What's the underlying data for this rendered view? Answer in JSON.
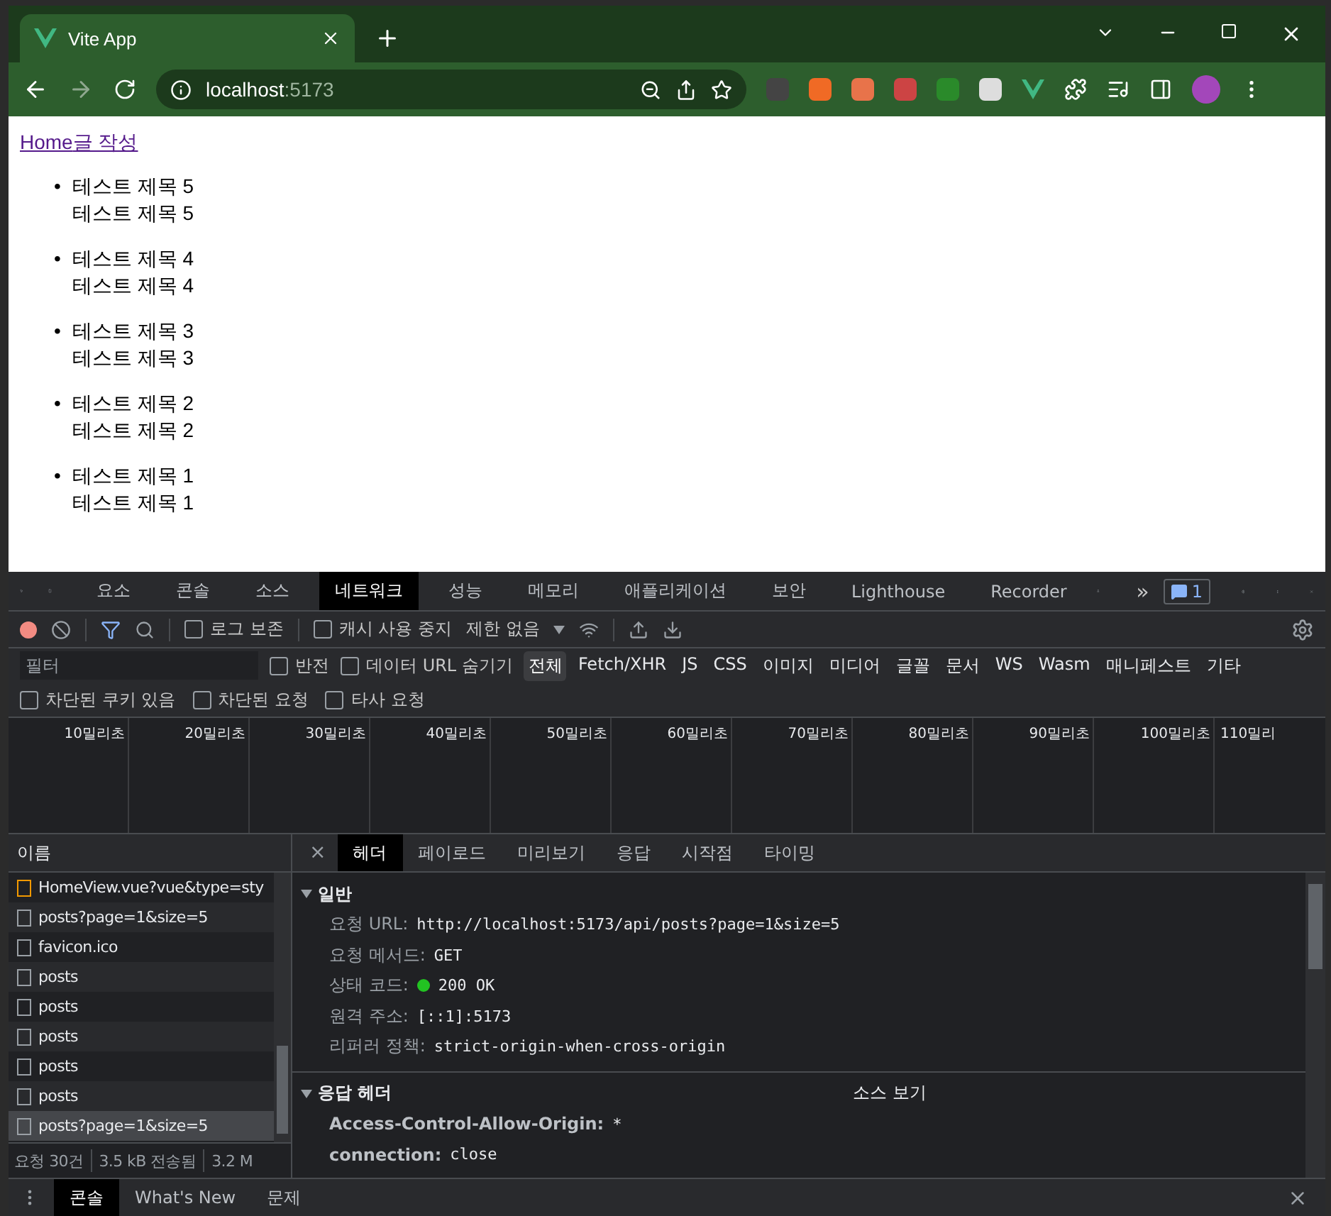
{
  "browser": {
    "tab_title": "Vite App",
    "url_host": "localhost",
    "url_port": ":5173"
  },
  "page": {
    "links": [
      "Home",
      "글 작성"
    ],
    "posts": [
      {
        "bullet": "•",
        "title": "테스트 제목 5",
        "content": "테스트 제목 5"
      },
      {
        "bullet": "•",
        "title": "테스트 제목 4",
        "content": "테스트 제목 4"
      },
      {
        "bullet": "•",
        "title": "테스트 제목 3",
        "content": "테스트 제목 3"
      },
      {
        "bullet": "•",
        "title": "테스트 제목 2",
        "content": "테스트 제목 2"
      },
      {
        "bullet": "•",
        "title": "테스트 제목 1",
        "content": "테스트 제목 1"
      }
    ]
  },
  "devtools": {
    "tabs": [
      {
        "label": "요소",
        "selected": false
      },
      {
        "label": "콘솔",
        "selected": false
      },
      {
        "label": "소스",
        "selected": false
      },
      {
        "label": "네트워크",
        "selected": true
      },
      {
        "label": "성능",
        "selected": false
      },
      {
        "label": "메모리",
        "selected": false
      },
      {
        "label": "애플리케이션",
        "selected": false
      },
      {
        "label": "보안",
        "selected": false
      },
      {
        "label": "Lighthouse",
        "selected": false
      },
      {
        "label": "Recorder",
        "selected": false
      }
    ],
    "more_tabs": "»",
    "issues_count": "1",
    "toolbar": {
      "preserve_log": {
        "label": "로그 보존",
        "checked": false
      },
      "disable_cache": {
        "label": "캐시 사용 중지",
        "checked": false
      },
      "throttling": "제한 없음"
    },
    "filter": {
      "placeholder": "필터",
      "invert": {
        "label": "반전",
        "checked": false
      },
      "hide_data_urls": {
        "label": "데이터 URL 숨기기",
        "checked": false
      },
      "types": [
        {
          "label": "전체",
          "selected": true
        },
        {
          "label": "Fetch/XHR",
          "selected": false
        },
        {
          "label": "JS",
          "selected": false
        },
        {
          "label": "CSS",
          "selected": false
        },
        {
          "label": "이미지",
          "selected": false
        },
        {
          "label": "미디어",
          "selected": false
        },
        {
          "label": "글꼴",
          "selected": false
        },
        {
          "label": "문서",
          "selected": false
        },
        {
          "label": "WS",
          "selected": false
        },
        {
          "label": "Wasm",
          "selected": false
        },
        {
          "label": "매니페스트",
          "selected": false
        },
        {
          "label": "기타",
          "selected": false
        }
      ],
      "options": [
        {
          "label": "차단된 쿠키 있음",
          "checked": false
        },
        {
          "label": "차단된 요청",
          "checked": false
        },
        {
          "label": "타사 요청",
          "checked": false
        }
      ]
    },
    "timeline_ticks": [
      "10밀리초",
      "20밀리초",
      "30밀리초",
      "40밀리초",
      "50밀리초",
      "60밀리초",
      "70밀리초",
      "80밀리초",
      "90밀리초",
      "100밀리초",
      "110밀리"
    ],
    "requests": {
      "column": "이름",
      "rows": [
        {
          "name": "HomeView.vue?vue&type=sty",
          "kind": "style",
          "selected": false
        },
        {
          "name": "posts?page=1&size=5",
          "kind": "fetch",
          "selected": false
        },
        {
          "name": "favicon.ico",
          "kind": "fetch",
          "selected": false
        },
        {
          "name": "posts",
          "kind": "fetch",
          "selected": false
        },
        {
          "name": "posts",
          "kind": "fetch",
          "selected": false
        },
        {
          "name": "posts",
          "kind": "fetch",
          "selected": false
        },
        {
          "name": "posts",
          "kind": "fetch",
          "selected": false
        },
        {
          "name": "posts",
          "kind": "fetch",
          "selected": false
        },
        {
          "name": "posts?page=1&size=5",
          "kind": "fetch",
          "selected": true
        }
      ],
      "summary": [
        "요청 30건",
        "3.5 kB 전송됨",
        "3.2 M"
      ]
    },
    "detail": {
      "close": "×",
      "tabs": [
        {
          "label": "헤더",
          "selected": true
        },
        {
          "label": "페이로드",
          "selected": false
        },
        {
          "label": "미리보기",
          "selected": false
        },
        {
          "label": "응답",
          "selected": false
        },
        {
          "label": "시작점",
          "selected": false
        },
        {
          "label": "타이밍",
          "selected": false
        }
      ],
      "general": {
        "title": "일반",
        "expanded": true,
        "rows": [
          {
            "key": "요청 URL:",
            "value": "http://localhost:5173/api/posts?page=1&size=5"
          },
          {
            "key": "요청 메서드:",
            "value": "GET"
          },
          {
            "key": "상태 코드:",
            "value": "200 OK",
            "color": "#22c322"
          },
          {
            "key": "원격 주소:",
            "value": "[::1]:5173"
          },
          {
            "key": "리퍼러 정책:",
            "value": "strict-origin-when-cross-origin"
          }
        ]
      },
      "response_headers": {
        "title": "응답 헤더",
        "expanded": true,
        "view_source": "소스 보기",
        "rows": [
          {
            "key": "Access-Control-Allow-Origin:",
            "value": "*"
          },
          {
            "key": "connection:",
            "value": "close"
          }
        ]
      }
    }
  },
  "drawer": {
    "tabs": [
      {
        "label": "콘솔",
        "selected": true
      },
      {
        "label": "What's New",
        "selected": false
      },
      {
        "label": "문제",
        "selected": false
      }
    ]
  }
}
